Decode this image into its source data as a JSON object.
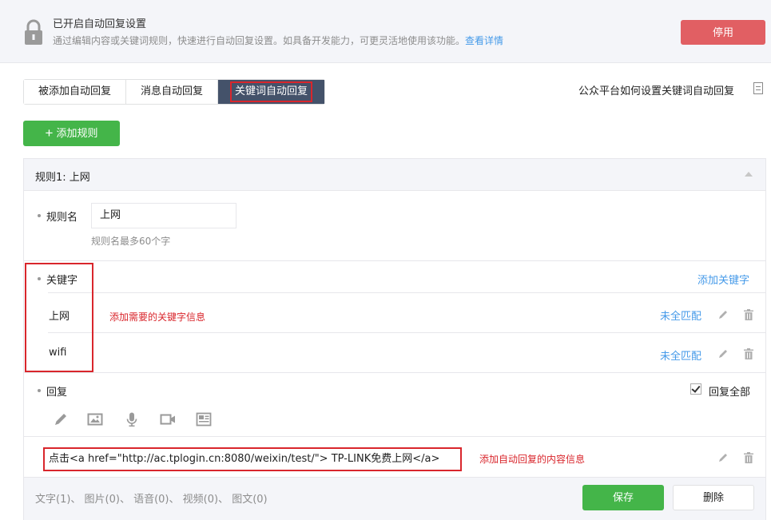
{
  "notice": {
    "title": "已开启自动回复设置",
    "desc": "通过编辑内容或关键词规则，快速进行自动回复设置。如具备开发能力，可更灵活地使用该功能。",
    "detail_link": "查看详情",
    "disable_label": "停用"
  },
  "tabs": [
    {
      "label": "被添加自动回复"
    },
    {
      "label": "消息自动回复"
    },
    {
      "label": "关键词自动回复",
      "active": true
    }
  ],
  "help_link": "公众平台如何设置关键词自动回复",
  "add_rule_label": "添加规则",
  "rule": {
    "title": "规则1: 上网",
    "name_label": "规则名",
    "name_value": "上网",
    "name_hint": "规则名最多60个字",
    "keyword_label": "关键字",
    "add_keyword": "添加关键字",
    "keywords": [
      {
        "text": "上网",
        "match": "未全匹配"
      },
      {
        "text": "wifi",
        "match": "未全匹配"
      }
    ],
    "keyword_note": "添加需要的关键字信息",
    "reply_label": "回复",
    "reply_all_label": "回复全部",
    "reply_all_checked": true,
    "reply_content": "点击<a href=\"http://ac.tplogin.cn:8080/weixin/test/\"> TP-LINK免费上网</a>",
    "reply_note": "添加自动回复的内容信息",
    "counts": "文字(1)、 图片(0)、 语音(0)、 视频(0)、 图文(0)",
    "save_label": "保存",
    "delete_label": "删除"
  },
  "colors": {
    "green": "#44b549",
    "red": "#e15f63",
    "annotation_red": "#d9262c",
    "link_blue": "#459ae9",
    "tab_active": "#44526a"
  }
}
